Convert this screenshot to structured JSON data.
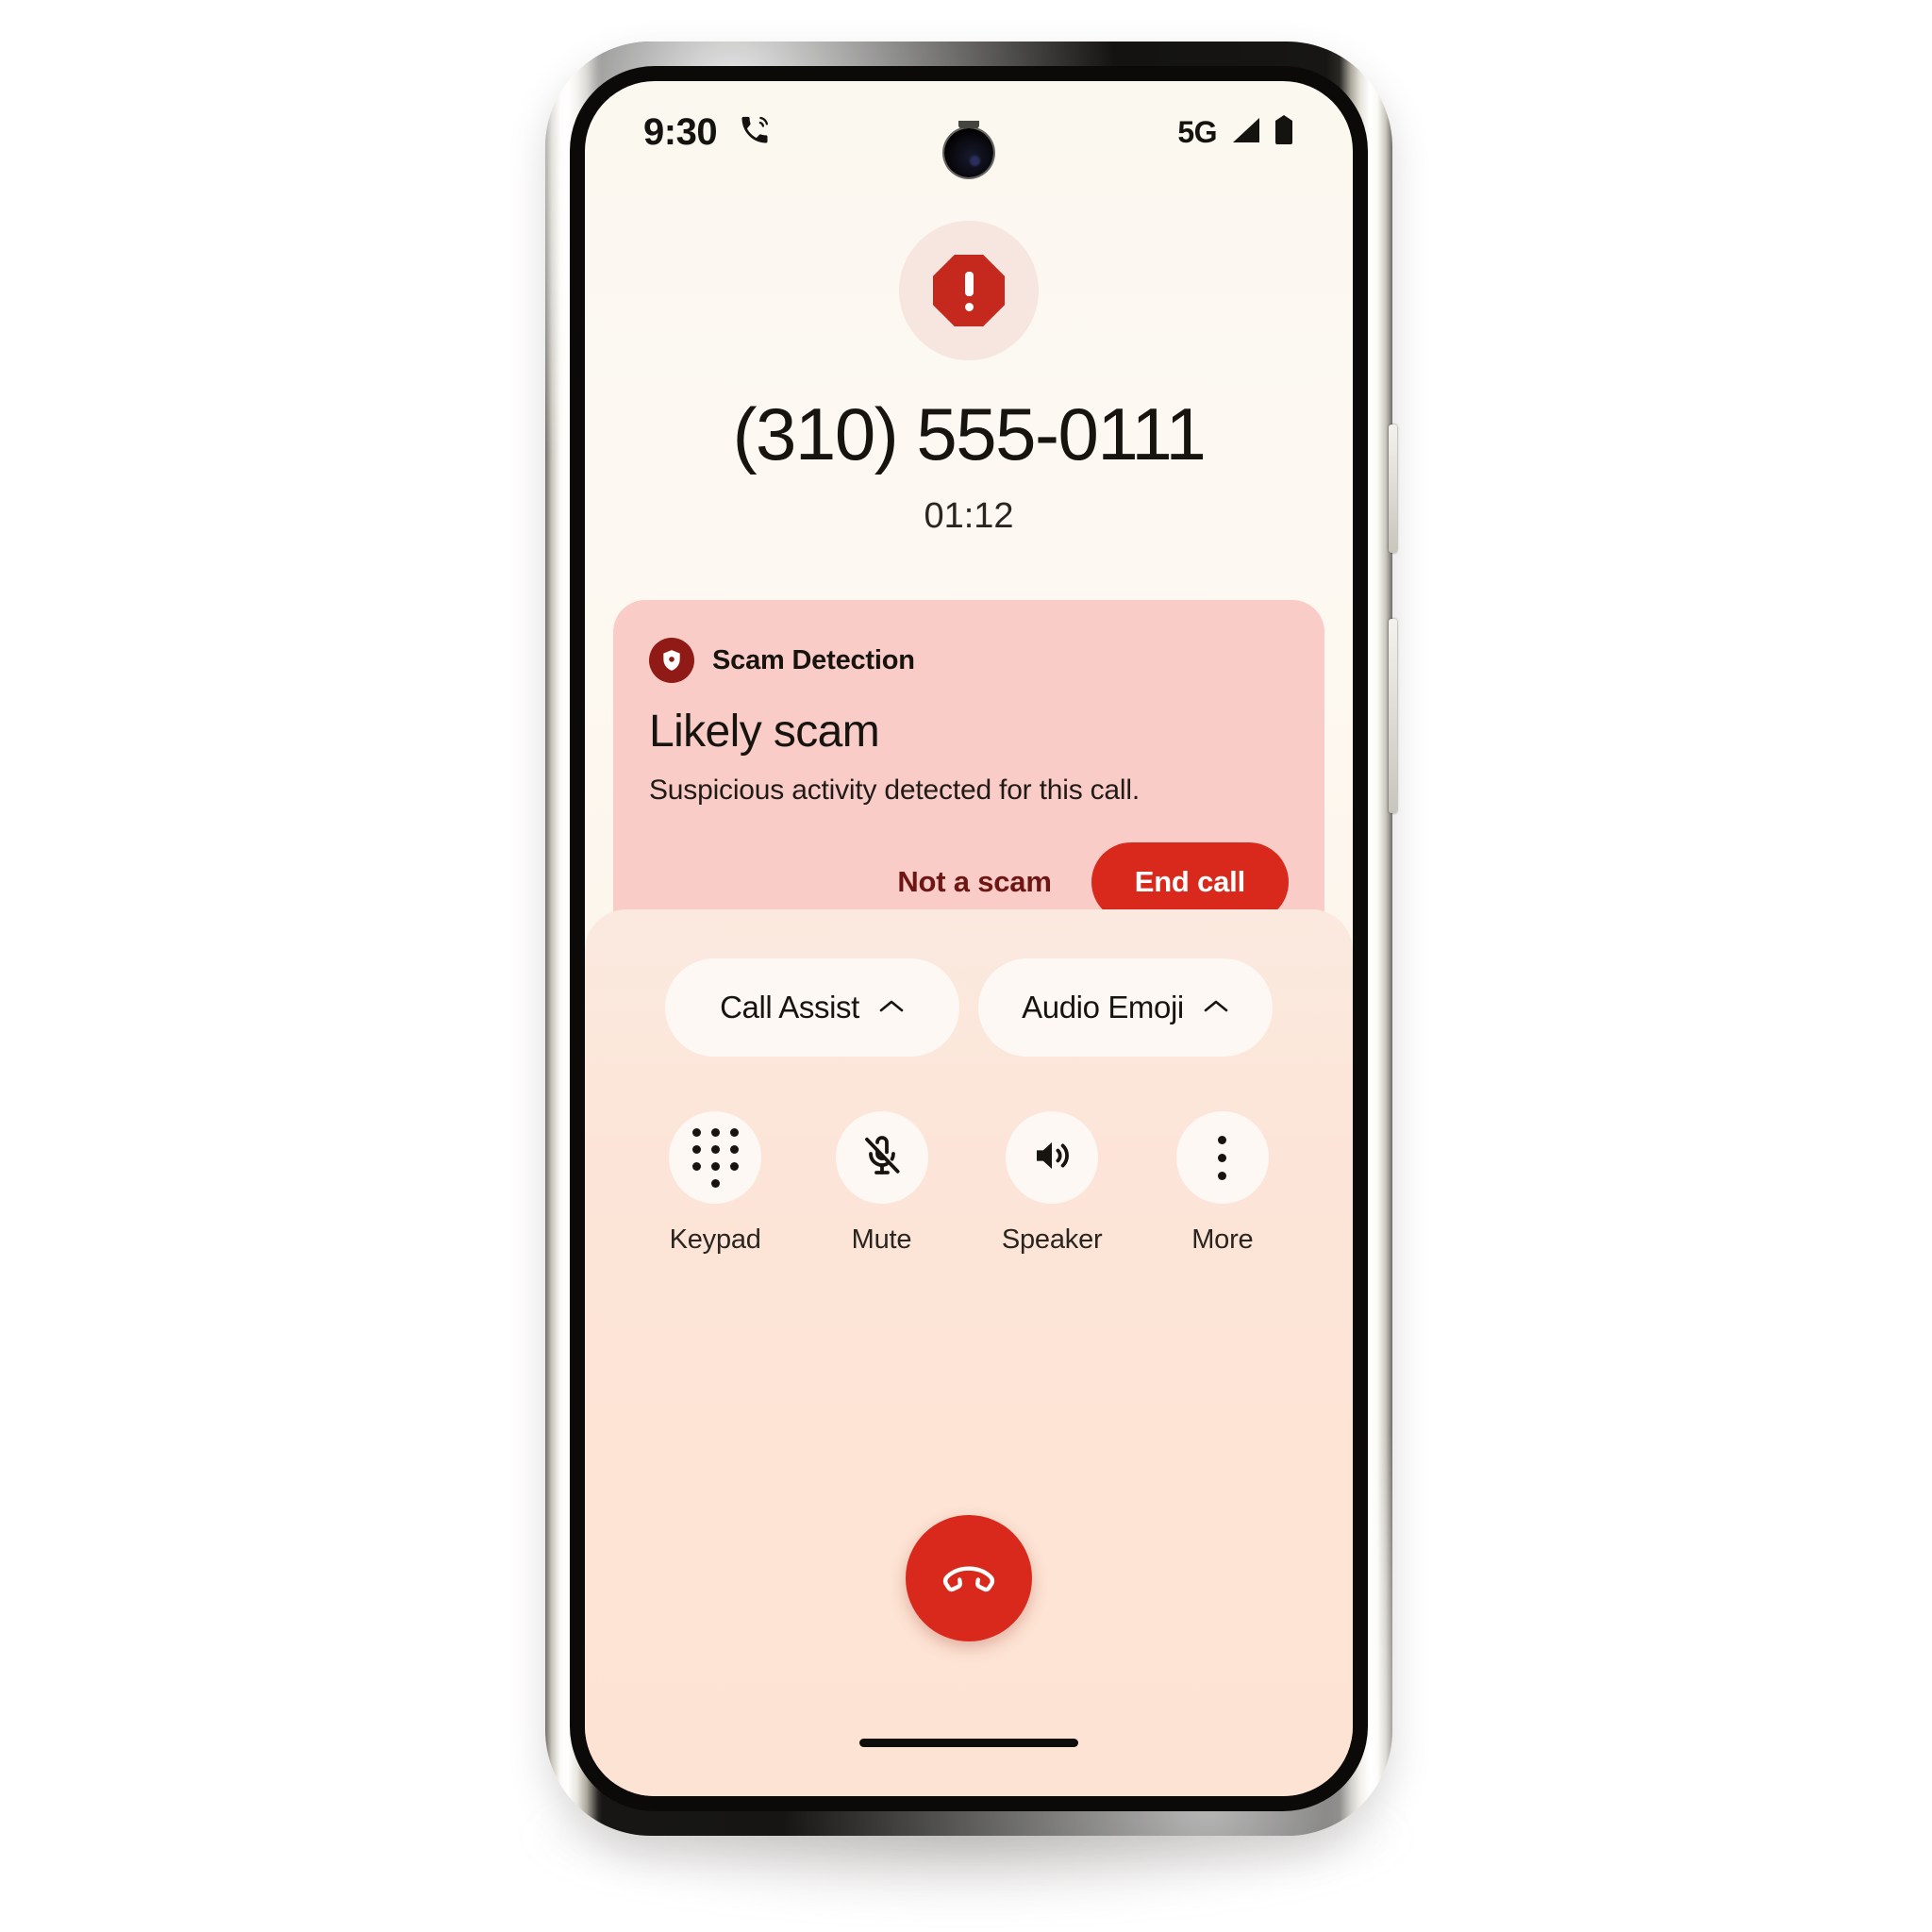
{
  "status_bar": {
    "time": "9:30",
    "call_icon": "active-call-icon",
    "network": "5G",
    "signal_icon": "signal-bars-icon",
    "battery_icon": "battery-icon"
  },
  "alert_badge": {
    "icon": "warning-octagon-icon",
    "color": "#c5281c",
    "halo_color": "#f6e6df"
  },
  "caller": {
    "number": "(310) 555-0111",
    "duration": "01:12"
  },
  "scam_card": {
    "background": "#f9ccc8",
    "shield_icon": "shield-icon",
    "label": "Scam Detection",
    "title": "Likely scam",
    "body": "Suspicious activity detected for this call.",
    "secondary_action": "Not a scam",
    "primary_action": "End call",
    "primary_color": "#d8291c",
    "secondary_color": "#6d1613"
  },
  "controls": {
    "chips": [
      {
        "label": "Call Assist",
        "icon": "chevron-up-icon"
      },
      {
        "label": "Audio Emoji",
        "icon": "chevron-up-icon"
      }
    ],
    "buttons": [
      {
        "label": "Keypad",
        "icon": "dialpad-icon"
      },
      {
        "label": "Mute",
        "icon": "mic-off-icon"
      },
      {
        "label": "Speaker",
        "icon": "speaker-icon"
      },
      {
        "label": "More",
        "icon": "more-vert-icon"
      }
    ],
    "end_call": {
      "icon": "call-end-icon",
      "color": "#d8291c"
    }
  }
}
